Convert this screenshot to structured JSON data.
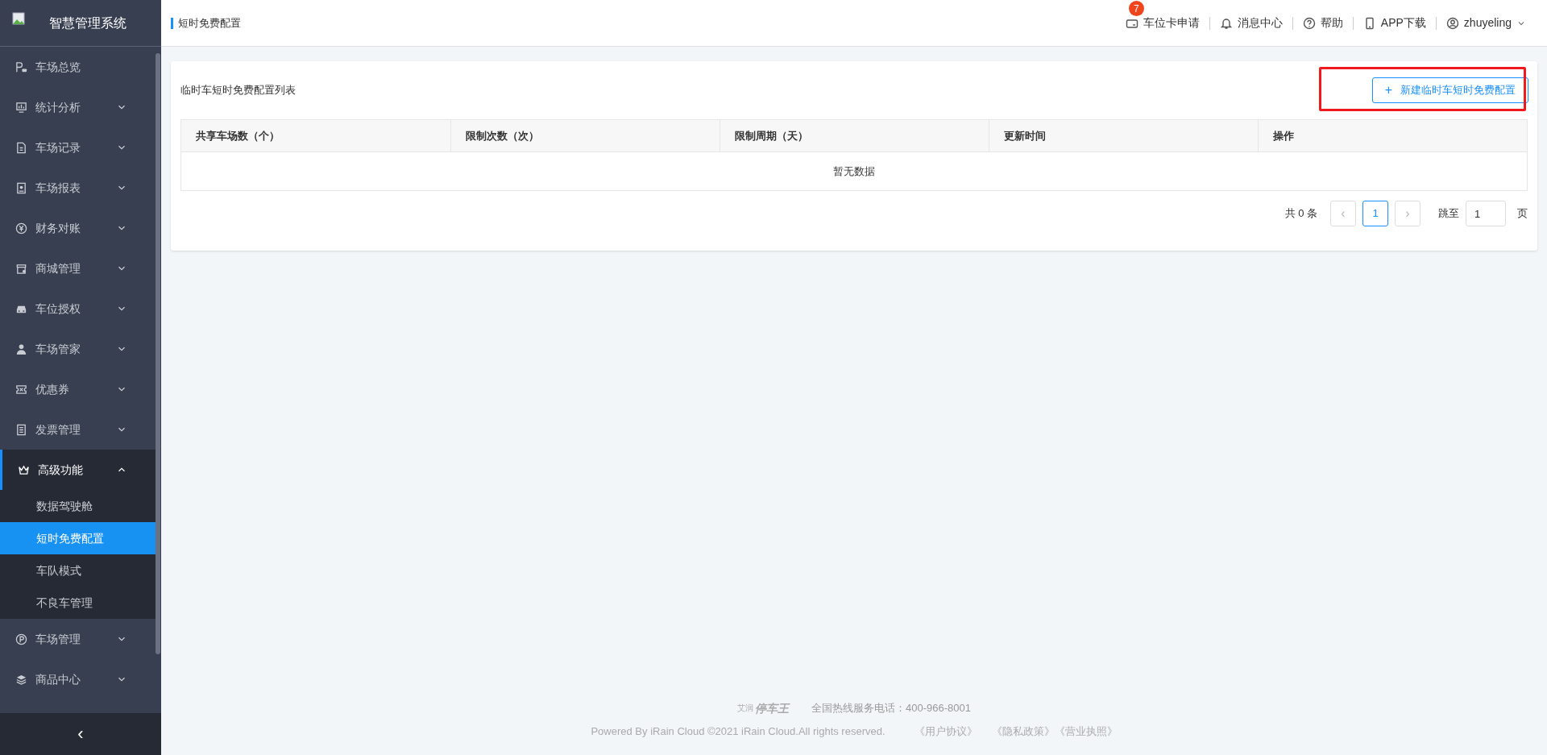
{
  "sidebar": {
    "title": "智慧管理系统",
    "items": [
      {
        "label": "车场总览",
        "has_children": false,
        "expanded": false
      },
      {
        "label": "统计分析",
        "has_children": true,
        "expanded": false
      },
      {
        "label": "车场记录",
        "has_children": true,
        "expanded": false
      },
      {
        "label": "车场报表",
        "has_children": true,
        "expanded": false
      },
      {
        "label": "财务对账",
        "has_children": true,
        "expanded": false
      },
      {
        "label": "商城管理",
        "has_children": true,
        "expanded": false
      },
      {
        "label": "车位授权",
        "has_children": true,
        "expanded": false
      },
      {
        "label": "车场管家",
        "has_children": true,
        "expanded": false
      },
      {
        "label": "优惠券",
        "has_children": true,
        "expanded": false
      },
      {
        "label": "发票管理",
        "has_children": true,
        "expanded": false
      },
      {
        "label": "高级功能",
        "has_children": true,
        "expanded": true,
        "children": [
          {
            "label": "数据驾驶舱",
            "selected": false
          },
          {
            "label": "短时免费配置",
            "selected": true
          },
          {
            "label": "车队模式",
            "selected": false
          },
          {
            "label": "不良车管理",
            "selected": false
          }
        ]
      },
      {
        "label": "车场管理",
        "has_children": true,
        "expanded": false
      },
      {
        "label": "商品中心",
        "has_children": true,
        "expanded": false
      }
    ],
    "collapse": "‹"
  },
  "header": {
    "breadcrumb": "短时免费配置",
    "actions": [
      {
        "label": "车位卡申请",
        "badge": "7"
      },
      {
        "label": "消息中心"
      },
      {
        "label": "帮助"
      },
      {
        "label": "APP下载"
      }
    ],
    "user": "zhuyeling"
  },
  "card": {
    "title": "临时车短时免费配置列表",
    "new_button": "+",
    "new_label": "新建临时车短时免费配置",
    "table": {
      "columns": [
        "共享车场数（个）",
        "限制次数（次）",
        "限制周期（天）",
        "更新时间",
        "操作"
      ],
      "empty": "暂无数据"
    },
    "pagination": {
      "total": "共 0 条",
      "prev": "‹",
      "pages": [
        {
          "label": "1",
          "selected": true
        }
      ],
      "next": "›",
      "jump_label": "跳至",
      "jump_value": "1",
      "page_unit": "页"
    }
  },
  "footer": {
    "logo_small": "艾润",
    "logo": "停车王",
    "hotline": "全国热线服务电话：400-966-8001",
    "copyright": "Powered By iRain Cloud ©2021 iRain Cloud.All rights reserved.",
    "links": [
      "《用户协议》",
      "《隐私政策》",
      "《营业执照》"
    ]
  }
}
